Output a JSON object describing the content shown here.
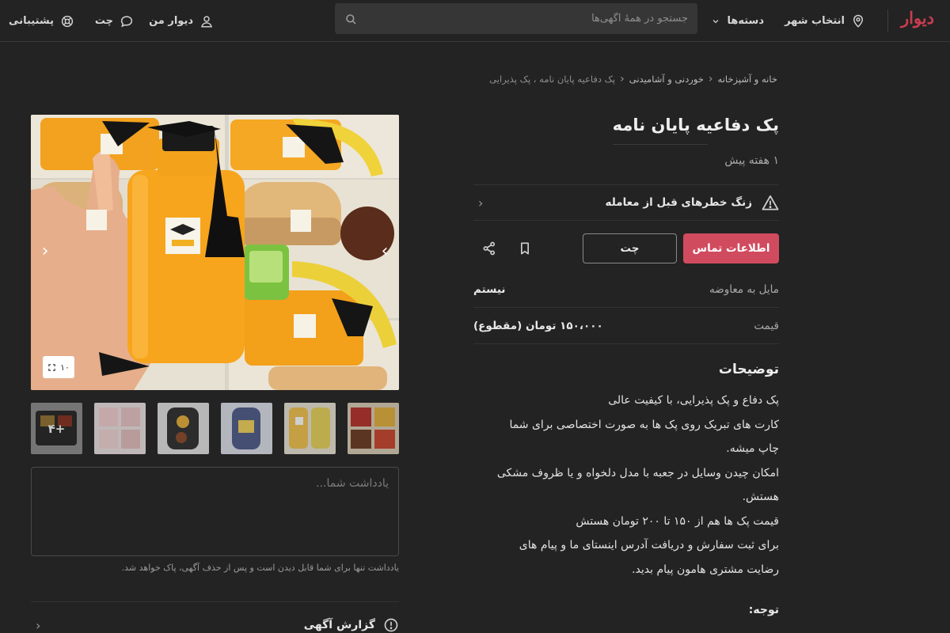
{
  "header": {
    "logo": "دیوار",
    "city_label": "انتخاب شهر",
    "categories_label": "دسته‌ها",
    "search_placeholder": "جستجو در همهٔ آگهی‌ها",
    "my_divar_label": "دیوار من",
    "chat_label": "چت",
    "support_label": "پشتیبانی"
  },
  "breadcrumb": [
    "خانه و آشپزخانه",
    "خوردنی و آشامیدنی",
    "پک دفاعیه پایان نامه ، پک پذیرایی"
  ],
  "listing": {
    "title": "پک دفاعیه پایان نامه",
    "posted": "۱ هفته پیش",
    "risk_label": "زنگ خطرهای قبل از معامله",
    "contact_button": "اطلاعات تماس",
    "chat_button": "چت",
    "negotiable_key": "مایل به معاوضه",
    "negotiable_value": "نیستم",
    "price_key": "قیمت",
    "price_value": "۱۵۰،۰۰۰ تومان (مقطوع)",
    "description_title": "توضیحات",
    "description_lines": [
      "پک دفاع و پک پذیرایی، با کیفیت عالی",
      "کارت های تبریک روی پک ها به صورت اختصاصی برای شما",
      "چاپ میشه.",
      "امکان چیدن وسایل در جعبه با مدل دلخواه و یا ظروف مشکی",
      "هستش.",
      "قیمت پک ها هم از ۱۵۰ تا ۲۰۰ تومان هستش",
      "برای ثبت سفارش و دریافت آدرس اینستای ما و پیام های",
      "رضایت مشتری هامون پیام بدید."
    ],
    "note_label": "توجه:"
  },
  "gallery": {
    "image_count": "۱۰",
    "more_thumbs": "+۴"
  },
  "note": {
    "placeholder": "یادداشت شما...",
    "hint": "یادداشت تنها برای شما قابل دیدن است و پس از حذف آگهی، پاک خواهد شد."
  },
  "report": {
    "label": "گزارش آگهی"
  },
  "colors": {
    "background": "#232323",
    "brand": "#c93d50",
    "contact_button": "#d14b5f"
  }
}
